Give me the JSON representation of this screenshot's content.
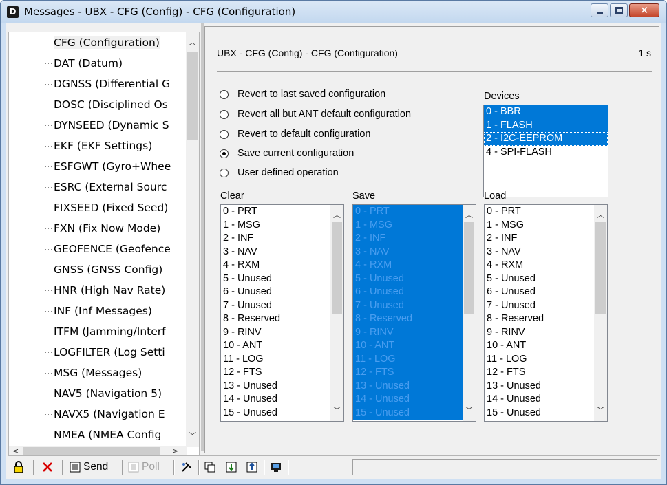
{
  "window": {
    "icon_letter": "D",
    "title": "Messages - UBX - CFG (Config) - CFG (Configuration)"
  },
  "tree": {
    "items": [
      {
        "label": "CFG (Configuration)",
        "selected": true
      },
      {
        "label": "DAT (Datum)"
      },
      {
        "label": "DGNSS (Differential G"
      },
      {
        "label": "DOSC (Disciplined Os"
      },
      {
        "label": "DYNSEED (Dynamic S"
      },
      {
        "label": "EKF (EKF Settings)"
      },
      {
        "label": "ESFGWT (Gyro+Whee"
      },
      {
        "label": "ESRC (External Sourc"
      },
      {
        "label": "FIXSEED (Fixed Seed)"
      },
      {
        "label": "FXN (Fix Now Mode)"
      },
      {
        "label": "GEOFENCE (Geofence"
      },
      {
        "label": "GNSS (GNSS Config)"
      },
      {
        "label": "HNR (High Nav Rate)"
      },
      {
        "label": "INF (Inf Messages)"
      },
      {
        "label": "ITFM (Jamming/Interf"
      },
      {
        "label": "LOGFILTER (Log Setti"
      },
      {
        "label": "MSG (Messages)"
      },
      {
        "label": "NAV5 (Navigation 5)"
      },
      {
        "label": "NAVX5 (Navigation E"
      },
      {
        "label": "NMEA (NMEA Config"
      }
    ]
  },
  "panel": {
    "title": "UBX - CFG (Config) - CFG (Configuration)",
    "rate": "1 s",
    "options": [
      {
        "label": "Revert to last saved configuration",
        "checked": false
      },
      {
        "label": "Revert all but ANT default configuration",
        "checked": false
      },
      {
        "label": "Revert to default configuration",
        "checked": false
      },
      {
        "label": "Save current configuration",
        "checked": true
      },
      {
        "label": "User defined operation",
        "checked": false
      }
    ],
    "devices_label": "Devices",
    "devices": [
      {
        "label": "0 - BBR",
        "selected": true
      },
      {
        "label": "1 - FLASH",
        "selected": true
      },
      {
        "label": "2 - I2C-EEPROM",
        "selected": true,
        "focus": true
      },
      {
        "label": "4 - SPI-FLASH",
        "selected": false
      }
    ],
    "clear_label": "Clear",
    "save_label": "Save",
    "load_label": "Load",
    "sections": [
      "0 - PRT",
      "1 - MSG",
      "2 - INF",
      "3 - NAV",
      "4 - RXM",
      "5 - Unused",
      "6 - Unused",
      "7 - Unused",
      "8 - Reserved",
      "9 - RINV",
      "10 - ANT",
      "11 - LOG",
      "12 - FTS",
      "13 - Unused",
      "14 - Unused",
      "15 - Unused"
    ]
  },
  "toolbar": {
    "send_label": "Send",
    "poll_label": "Poll",
    "status_text": ""
  }
}
